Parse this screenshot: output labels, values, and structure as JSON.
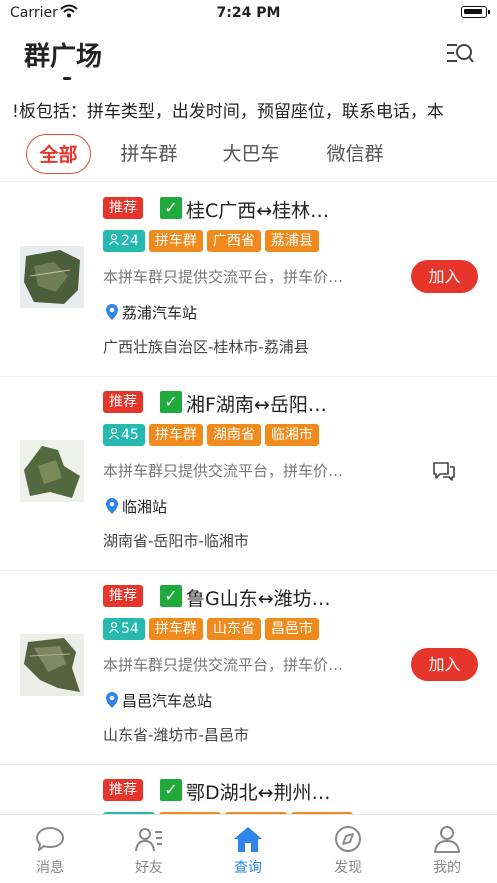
{
  "status_bar": {
    "carrier": "Carrier",
    "time": "7:24 PM"
  },
  "nav": {
    "title": "群广场"
  },
  "marquee": {
    "text": "!板包括：拼车类型，出发时间，预留座位，联系电话，本"
  },
  "tabs": [
    {
      "label": "全部",
      "active": true
    },
    {
      "label": "拼车群",
      "active": false
    },
    {
      "label": "大巴车",
      "active": false
    },
    {
      "label": "微信群",
      "active": false
    }
  ],
  "cards": [
    {
      "badge": "推荐",
      "title": "桂C广西↔桂林…",
      "members": "24",
      "tags": [
        "拼车群",
        "广西省",
        "荔浦县"
      ],
      "desc": "本拼车群只提供交流平台，拼车价…",
      "station": "荔浦汽车站",
      "region": "广西壮族自治区-桂林市-荔浦县",
      "action": "加入",
      "action_type": "join"
    },
    {
      "badge": "推荐",
      "title": "湘F湖南↔岳阳…",
      "members": "45",
      "tags": [
        "拼车群",
        "湖南省",
        "临湘市"
      ],
      "desc": "本拼车群只提供交流平台，拼车价…",
      "station": "临湘站",
      "region": "湖南省-岳阳市-临湘市",
      "action": "",
      "action_type": "chat"
    },
    {
      "badge": "推荐",
      "title": "鲁G山东↔潍坊…",
      "members": "54",
      "tags": [
        "拼车群",
        "山东省",
        "昌邑市"
      ],
      "desc": "本拼车群只提供交流平台，拼车价…",
      "station": "昌邑汽车总站",
      "region": "山东省-潍坊市-昌邑市",
      "action": "加入",
      "action_type": "join"
    },
    {
      "badge": "推荐",
      "title": "鄂D湖北↔荆州…",
      "members": "",
      "tags": [],
      "desc": "",
      "station": "",
      "region": "",
      "action": "",
      "action_type": "none"
    }
  ],
  "tabbar": [
    {
      "label": "消息",
      "icon": "message-icon",
      "active": false
    },
    {
      "label": "好友",
      "icon": "friends-icon",
      "active": false
    },
    {
      "label": "查询",
      "icon": "home-icon",
      "active": true
    },
    {
      "label": "发现",
      "icon": "compass-icon",
      "active": false
    },
    {
      "label": "我的",
      "icon": "profile-icon",
      "active": false
    }
  ],
  "colors": {
    "accent_red": "#e6352b",
    "teal": "#25b9b0",
    "orange": "#f08a1c",
    "tab_active": "#2f86e8"
  }
}
